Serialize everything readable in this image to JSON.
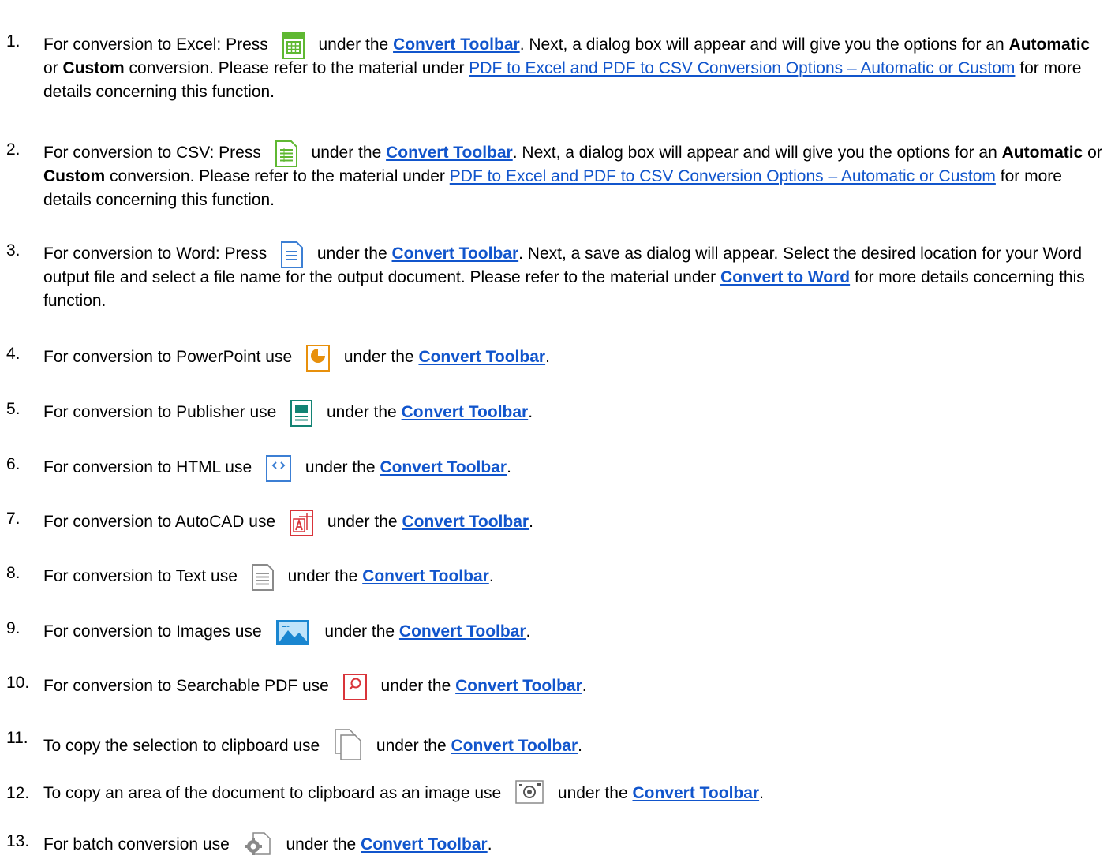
{
  "items": [
    {
      "num": "1.",
      "pre": "For conversion to Excel: Press",
      "post": "under the",
      "link": "Convert Toolbar",
      "rest_a": ". Next, a dialog box will appear and will give you the options for an",
      "bold_a": "Automatic",
      "rest_b": "or",
      "bold_b": "Custom",
      "rest_c": "conversion. Please refer to the material under",
      "ref": "PDF to Excel and PDF to CSV Conversion Options – Automatic or Custom",
      "rest_d": "for more details concerning this function.",
      "icon": "excel-icon"
    },
    {
      "num": "2.",
      "pre": "For conversion to CSV: Press",
      "post": "under the",
      "link": "Convert Toolbar",
      "rest_a": ". Next, a dialog box will appear and will give you the options for an",
      "bold_a": "Automatic",
      "rest_b": "or",
      "bold_b": "Custom",
      "rest_c": "conversion. Please refer to the material under",
      "ref": "PDF to Excel and PDF to CSV Conversion Options – Automatic or Custom",
      "rest_d": "for more details concerning this function.",
      "icon": "csv-icon"
    },
    {
      "num": "3.",
      "pre": "For conversion to Word: Press",
      "post": "under the",
      "link": "Convert Toolbar",
      "rest_a": ". Next, a save as dialog will appear. Select the desired location for your Word output file and select a file name for the output document. Please refer to the material under",
      "bold_link": "Convert to Word",
      "rest_d": "for more details concerning this function.",
      "icon": "word-icon"
    },
    {
      "num": "4.",
      "pre": "For conversion to PowerPoint use",
      "post": "under the",
      "link": "Convert Toolbar",
      "end": ".",
      "icon": "powerpoint-icon"
    },
    {
      "num": "5.",
      "pre": "For conversion to Publisher use",
      "post": "under the",
      "link": "Convert Toolbar",
      "end": ".",
      "icon": "publisher-icon"
    },
    {
      "num": "6.",
      "pre": "For conversion to HTML use",
      "post": "under the",
      "link": "Convert Toolbar",
      "end": ".",
      "icon": "html-icon"
    },
    {
      "num": "7.",
      "pre": "For conversion to AutoCAD use",
      "post": "under the",
      "link": "Convert Toolbar",
      "end": ".",
      "icon": "autocad-icon"
    },
    {
      "num": "8.",
      "pre": "For conversion to Text use",
      "post": "under the",
      "link": "Convert Toolbar",
      "end": ".",
      "icon": "text-icon"
    },
    {
      "num": "9.",
      "pre": "For conversion to Images use",
      "post": "under the",
      "link": "Convert Toolbar",
      "end": ".",
      "icon": "image-icon"
    },
    {
      "num": "10.",
      "pre": "For conversion to Searchable PDF use",
      "post": "under the",
      "link": "Convert Toolbar",
      "end": ".",
      "icon": "searchable-pdf-icon"
    },
    {
      "num": "11.",
      "pre": "To copy the selection to clipboard use",
      "post": "under the",
      "link": "Convert Toolbar",
      "end": ".",
      "icon": "copy-icon"
    },
    {
      "num": "12.",
      "pre": "To copy an area of the document to clipboard as an image use",
      "post": "under the",
      "link": "Convert Toolbar",
      "end": ".",
      "icon": "camera-icon"
    },
    {
      "num": "13.",
      "pre": "For batch conversion use",
      "post": "under the",
      "link": "Convert Toolbar",
      "end": ".",
      "icon": "batch-convert-icon"
    }
  ],
  "colors": {
    "link": "#1155cc",
    "excel": "#5fb832",
    "csv": "#5fb832",
    "word": "#3c7fd4",
    "powerpoint": "#e8900c",
    "publisher": "#138374",
    "html": "#3c7fd4",
    "autocad": "#d9343a",
    "image": "#1a86d0",
    "searchable": "#d9343a",
    "gray": "#8a8a8a"
  }
}
